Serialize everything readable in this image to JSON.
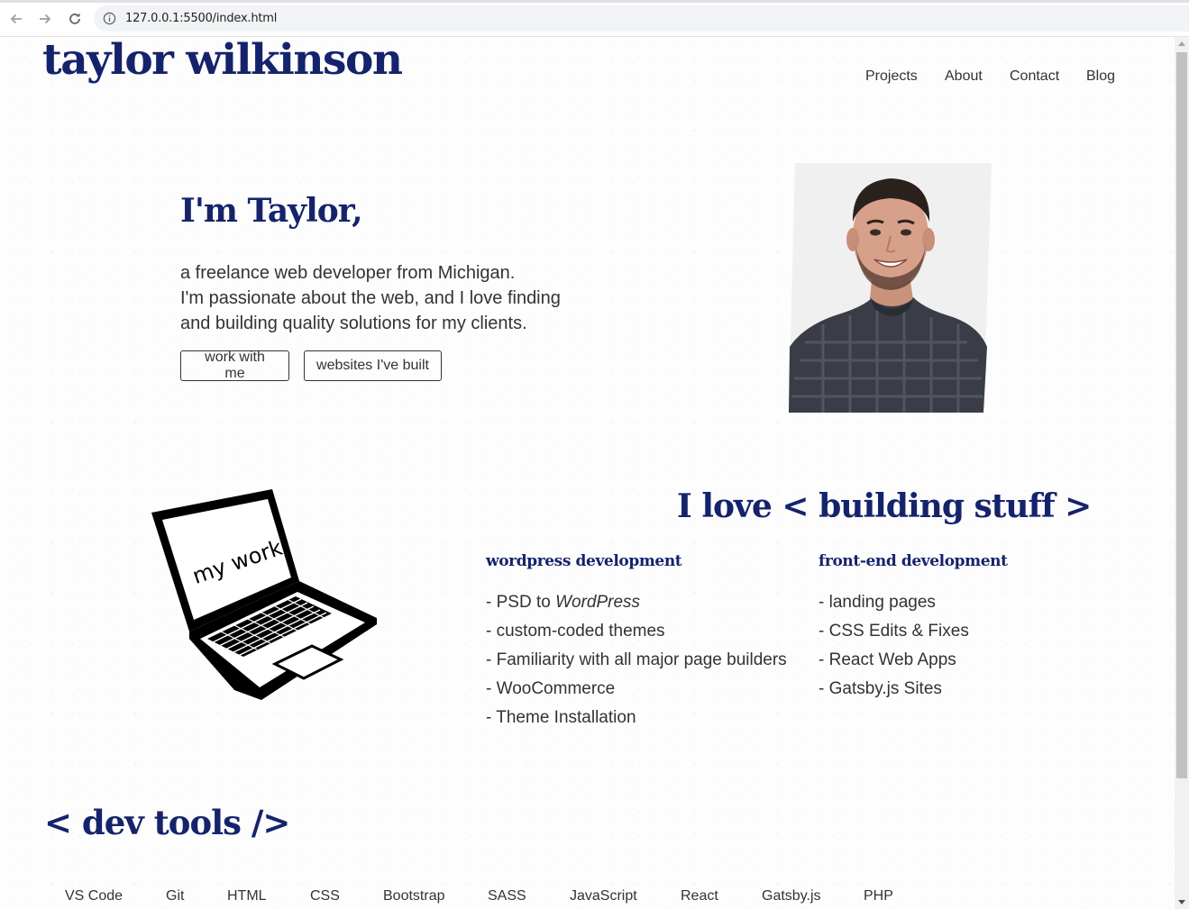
{
  "browser": {
    "url": "127.0.0.1:5500/index.html",
    "icons": {
      "back": "arrow-left-icon",
      "forward": "arrow-right-icon",
      "reload": "reload-icon",
      "info": "info-icon"
    }
  },
  "header": {
    "site_title": "taylor wilkinson",
    "nav": [
      {
        "label": "Projects"
      },
      {
        "label": "About"
      },
      {
        "label": "Contact"
      },
      {
        "label": "Blog"
      }
    ]
  },
  "hero": {
    "heading": "I'm Taylor,",
    "lines": [
      "a freelance web developer from Michigan.",
      "I'm passionate about the web, and I love finding",
      "and building quality solutions for my clients."
    ],
    "buttons": {
      "primary": "work with me",
      "secondary": "websites I've built"
    },
    "portrait_image": "portrait-photo"
  },
  "skills": {
    "laptop_screen_text": "my work",
    "heading": "I love < building stuff >",
    "columns": [
      {
        "title": "wordpress development",
        "items": [
          {
            "prefix": "- PSD to ",
            "em": "WordPress"
          },
          {
            "prefix": "- custom-coded themes"
          },
          {
            "prefix": "- Familiarity with all major page builders"
          },
          {
            "prefix": "- WooCommerce"
          },
          {
            "prefix": "- Theme Installation"
          }
        ]
      },
      {
        "title": "front-end development",
        "items": [
          {
            "prefix": "- landing pages"
          },
          {
            "prefix": "- CSS Edits & Fixes"
          },
          {
            "prefix": "- React Web Apps"
          },
          {
            "prefix": "- Gatsby.js Sites"
          }
        ]
      }
    ]
  },
  "dev_tools": {
    "heading": "< dev tools />",
    "tools": [
      "VS Code",
      "Git",
      "HTML",
      "CSS",
      "Bootstrap",
      "SASS",
      "JavaScript",
      "React",
      "Gatsby.js",
      "PHP"
    ]
  },
  "colors": {
    "accent": "#15236b",
    "text": "#333333"
  }
}
